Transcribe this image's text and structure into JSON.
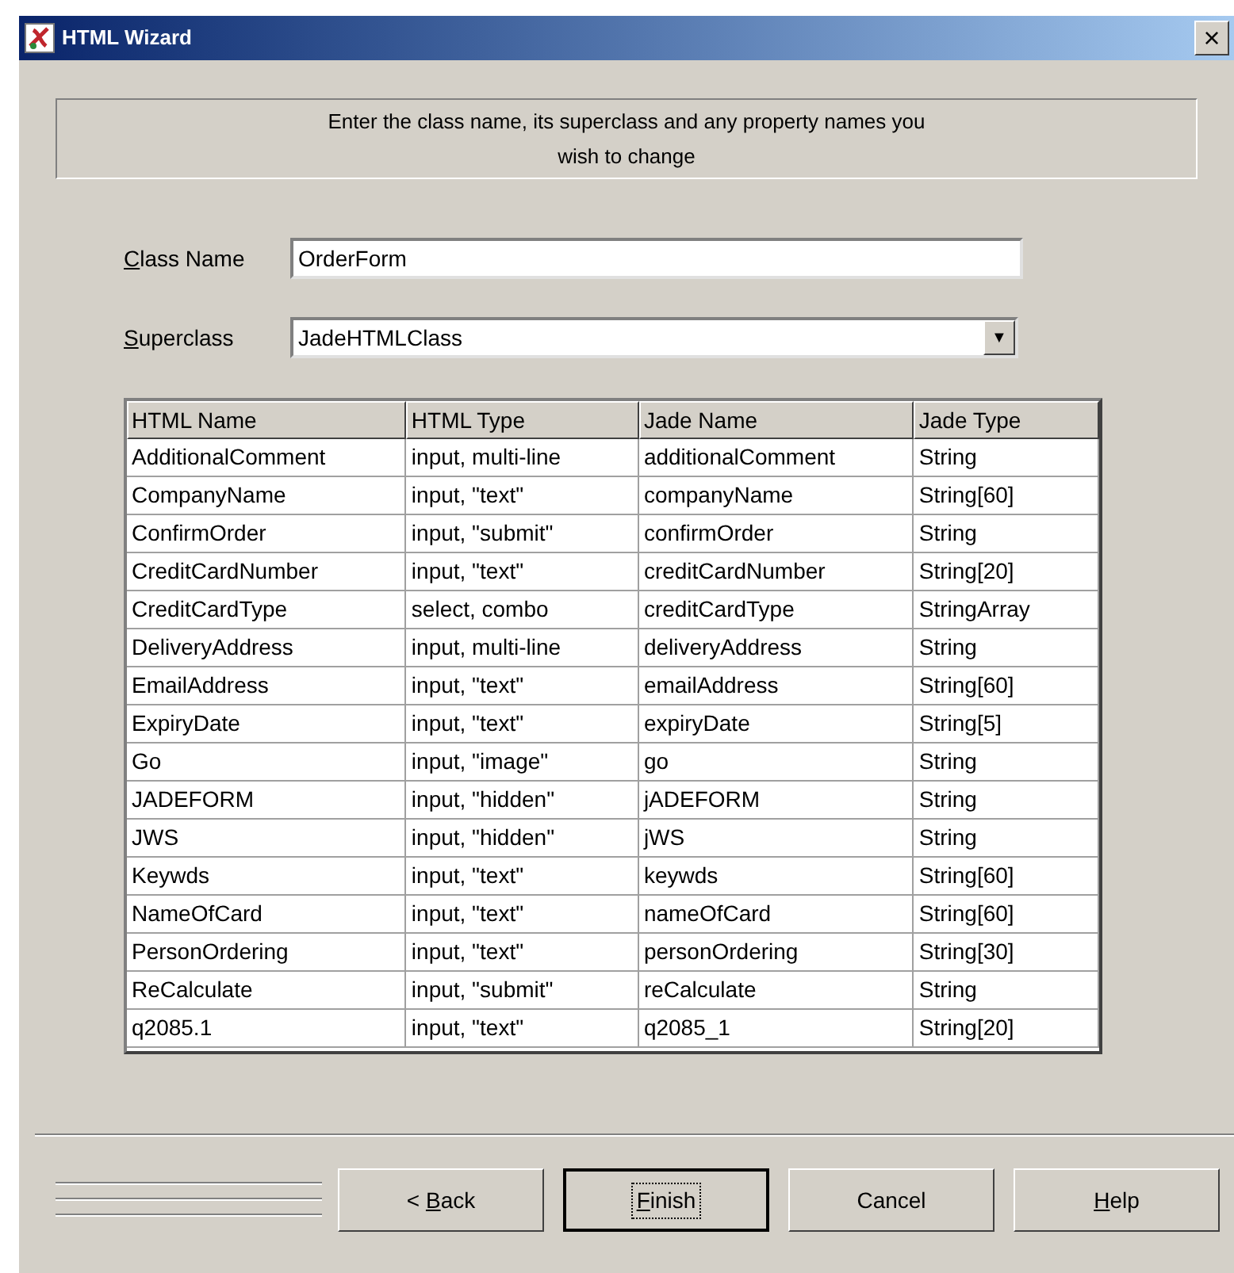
{
  "window": {
    "title": "HTML Wizard",
    "close": "×"
  },
  "instructions": "Enter the class name, its superclass and any property names you wish to change",
  "class_name": {
    "label": [
      {
        "text": "C",
        "underlined": true
      },
      {
        "text": "lass Name",
        "underlined": false
      }
    ],
    "value": "OrderForm"
  },
  "superclass": {
    "label": [
      {
        "text": "S",
        "underlined": true
      },
      {
        "text": "uperclass",
        "underlined": false
      }
    ],
    "value": "JadeHTMLClass",
    "arrow": "▼"
  },
  "table": {
    "columns": [
      "HTML Name",
      "HTML Type",
      "Jade Name",
      "Jade Type"
    ],
    "rows": [
      [
        "AdditionalComment",
        "input, multi-line",
        "additionalComment",
        "String"
      ],
      [
        "CompanyName",
        "input, \"text\"",
        "companyName",
        "String[60]"
      ],
      [
        "ConfirmOrder",
        "input, \"submit\"",
        "confirmOrder",
        "String"
      ],
      [
        "CreditCardNumber",
        "input, \"text\"",
        "creditCardNumber",
        "String[20]"
      ],
      [
        "CreditCardType",
        "select, combo",
        "creditCardType",
        "StringArray"
      ],
      [
        "DeliveryAddress",
        "input, multi-line",
        "deliveryAddress",
        "String"
      ],
      [
        "EmailAddress",
        "input, \"text\"",
        "emailAddress",
        "String[60]"
      ],
      [
        "ExpiryDate",
        "input, \"text\"",
        "expiryDate",
        "String[5]"
      ],
      [
        "Go",
        "input, \"image\"",
        "go",
        "String"
      ],
      [
        "JADEFORM",
        "input, \"hidden\"",
        "jADEFORM",
        "String"
      ],
      [
        "JWS",
        "input, \"hidden\"",
        "jWS",
        "String"
      ],
      [
        "Keywds",
        "input, \"text\"",
        "keywds",
        "String[60]"
      ],
      [
        "NameOfCard",
        "input, \"text\"",
        "nameOfCard",
        "String[60]"
      ],
      [
        "PersonOrdering",
        "input, \"text\"",
        "personOrdering",
        "String[30]"
      ],
      [
        "ReCalculate",
        "input, \"submit\"",
        "reCalculate",
        "String"
      ],
      [
        "q2085.1",
        "input, \"text\"",
        "q2085_1",
        "String[20]"
      ]
    ]
  },
  "buttons": [
    {
      "label": [
        {
          "text": "< ",
          "underlined": false
        },
        {
          "text": "B",
          "underlined": true
        },
        {
          "text": "ack",
          "underlined": false
        }
      ],
      "default": false
    },
    {
      "label": [
        {
          "text": "F",
          "underlined": true
        },
        {
          "text": "inish",
          "underlined": false
        }
      ],
      "default": true
    },
    {
      "label": [
        {
          "text": "Cancel",
          "underlined": false
        }
      ],
      "default": false
    },
    {
      "label": [
        {
          "text": "H",
          "underlined": true
        },
        {
          "text": "elp",
          "underlined": false
        }
      ],
      "default": false
    }
  ]
}
